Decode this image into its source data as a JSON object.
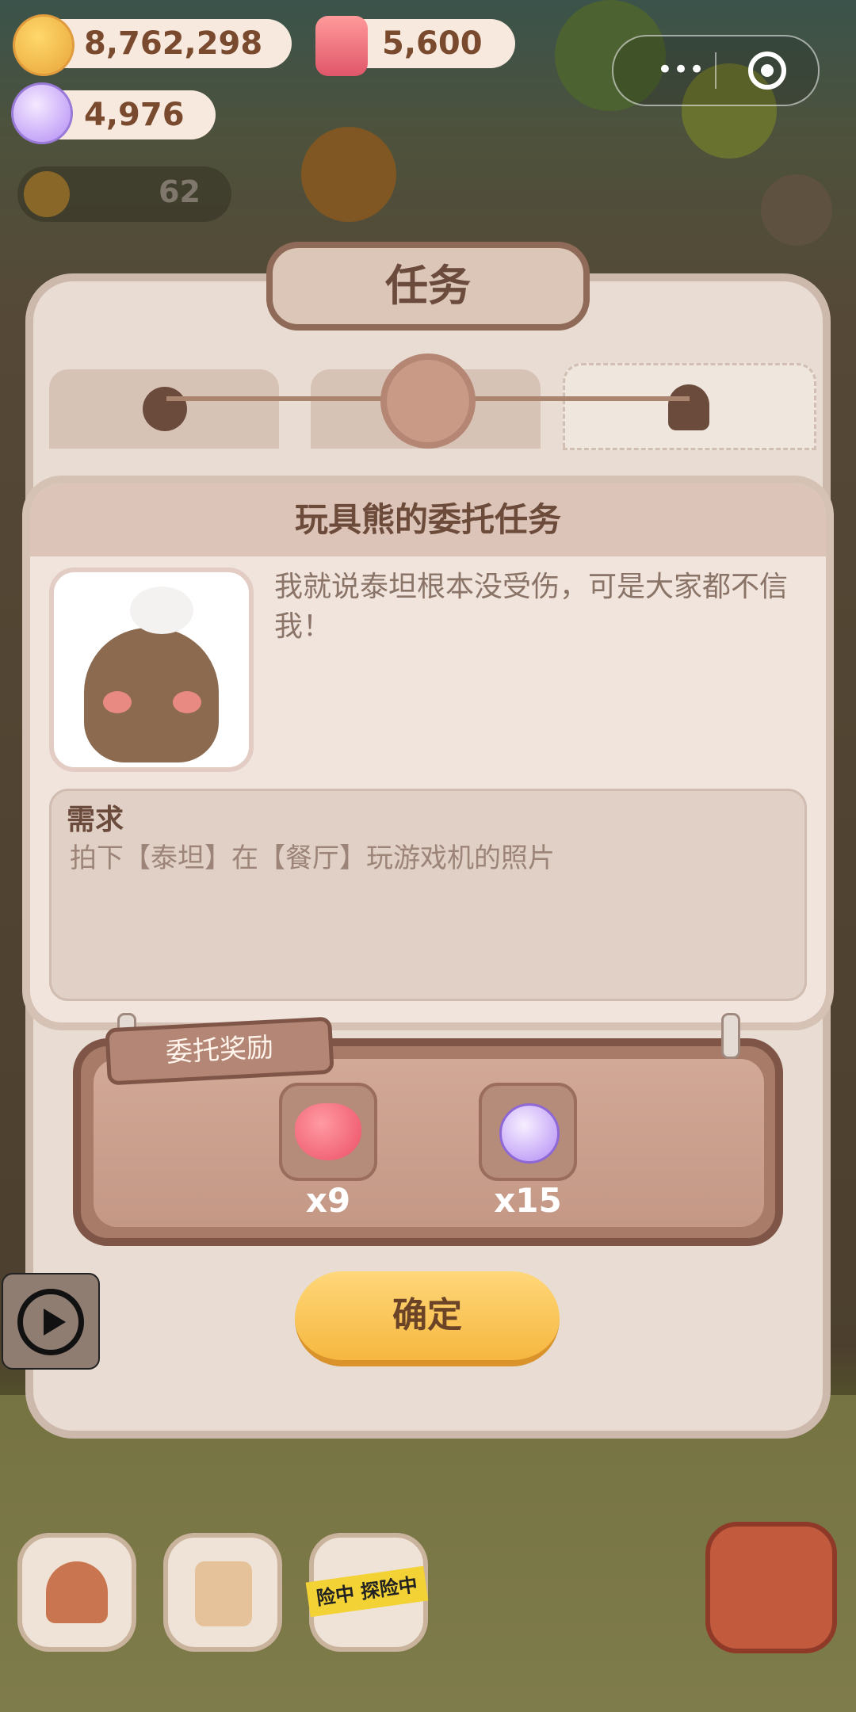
{
  "currency": {
    "coins": "8,762,298",
    "gems": "5,600",
    "candy": "4,976"
  },
  "background": {
    "badge_count": "62"
  },
  "capsule": {
    "more_label": "•••"
  },
  "panel": {
    "title": "任务"
  },
  "dialog": {
    "title": "玩具熊的委托任务",
    "speech": "我就说泰坦根本没受伤，可是大家都不信我！",
    "requirement_label": "需求",
    "requirement_text": "拍下【泰坦】在【餐厅】玩游戏机的照片"
  },
  "rewards": {
    "label": "委托奖励",
    "items": [
      {
        "icon": "heart-icon",
        "count": "x9"
      },
      {
        "icon": "candy-icon",
        "count": "x15"
      }
    ]
  },
  "confirm_label": "确定",
  "bottom_nav": {
    "tape_text": "险中 探险中"
  },
  "colors": {
    "accent": "#f6b73f",
    "panel": "#e8dcd3",
    "board": "#a87b68"
  }
}
